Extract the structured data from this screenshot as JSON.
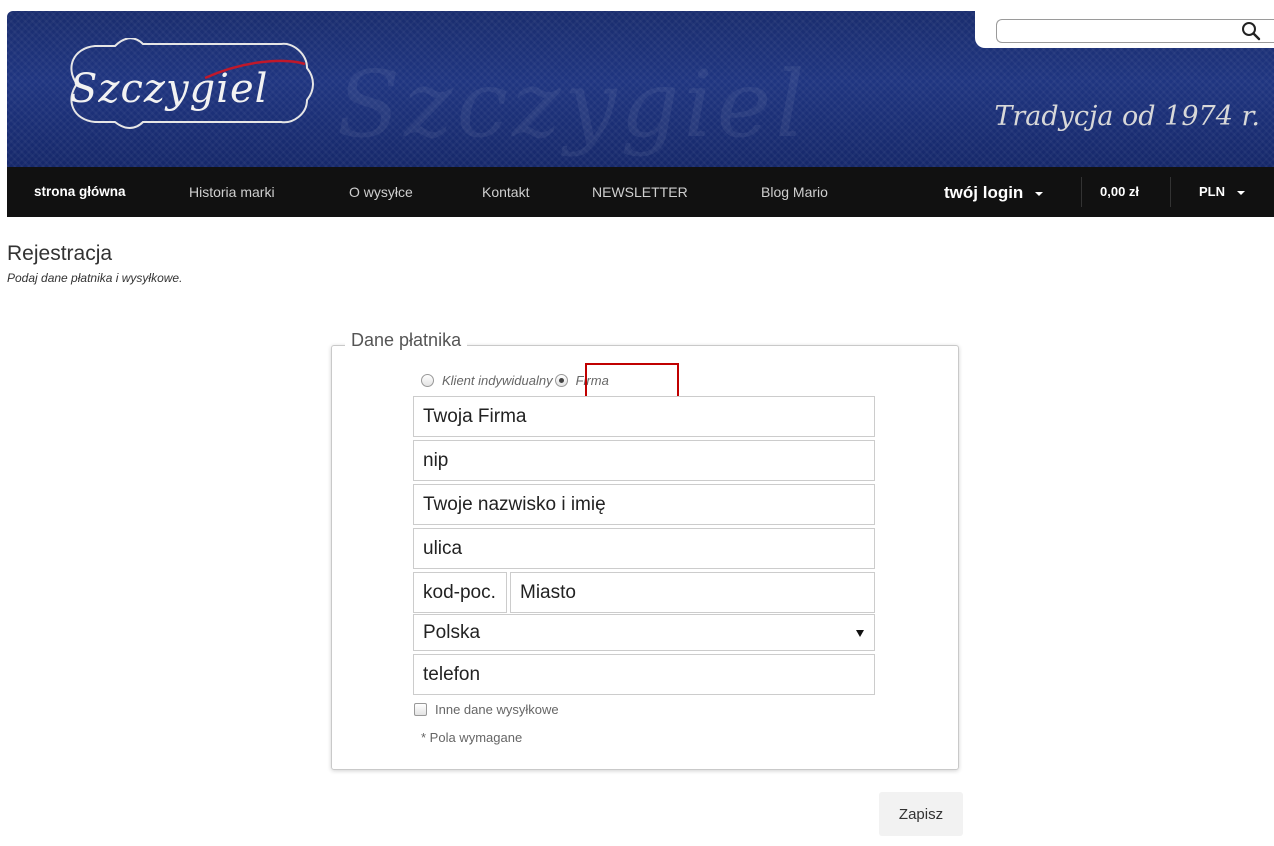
{
  "header": {
    "logo_text": "Szczygiel",
    "tagline": "Tradycja od 1974 r.",
    "search": {
      "value": "",
      "placeholder": ""
    }
  },
  "nav": {
    "items": [
      {
        "label": "strona główna",
        "active": true
      },
      {
        "label": "Historia marki"
      },
      {
        "label": "O wysyłce"
      },
      {
        "label": "Kontakt"
      },
      {
        "label": "NEWSLETTER"
      },
      {
        "label": "Blog Mario"
      }
    ],
    "login_label": "twój login",
    "cart_amount": "0,00 zł",
    "currency": "PLN"
  },
  "page": {
    "title": "Rejestracja",
    "subtitle": "Podaj dane płatnika i wysyłkowe."
  },
  "form": {
    "legend": "Dane płatnika",
    "customer_type": {
      "options": [
        "Klient indywidualny",
        "Firma"
      ],
      "selected": "Firma"
    },
    "fields": {
      "company": "Twoja Firma",
      "nip": "nip",
      "name": "Twoje nazwisko i imię",
      "street": "ulica",
      "postal_code": "kod-poc.",
      "city": "Miasto",
      "country": "Polska",
      "phone": "telefon"
    },
    "other_shipping_label": "Inne dane wysyłkowe",
    "required_note": "* Pola wymagane",
    "save_label": "Zapisz"
  },
  "colors": {
    "banner": "#1f3580",
    "nav_bg": "#111111",
    "highlight_border": "#c00000"
  }
}
